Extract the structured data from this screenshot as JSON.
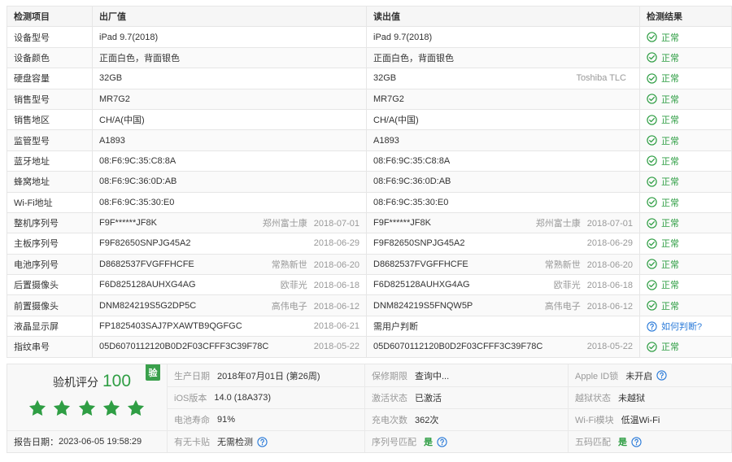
{
  "colors": {
    "ok": "#2f9e44",
    "link": "#2b7bd9",
    "muted": "#999999",
    "text": "#333333",
    "badge": "#3aa04c"
  },
  "table": {
    "headers": {
      "item": "检测项目",
      "factory": "出厂值",
      "read": "读出值",
      "result": "检测结果"
    },
    "rows": [
      {
        "item": "设备型号",
        "factory": {
          "value": "iPad 9.7(2018)"
        },
        "read": {
          "value": "iPad 9.7(2018)"
        },
        "result": {
          "icon": "check-circle-icon",
          "label": "正常"
        }
      },
      {
        "item": "设备颜色",
        "factory": {
          "value": "正面白色，背面银色"
        },
        "read": {
          "value": "正面白色，背面银色"
        },
        "result": {
          "icon": "check-circle-icon",
          "label": "正常"
        }
      },
      {
        "item": "硬盘容量",
        "factory": {
          "value": "32GB"
        },
        "read": {
          "value": "32GB",
          "vendor": "Toshiba TLC"
        },
        "result": {
          "icon": "check-circle-icon",
          "label": "正常"
        }
      },
      {
        "item": "销售型号",
        "factory": {
          "value": "MR7G2"
        },
        "read": {
          "value": "MR7G2"
        },
        "result": {
          "icon": "check-circle-icon",
          "label": "正常"
        }
      },
      {
        "item": "销售地区",
        "factory": {
          "value": "CH/A(中国)"
        },
        "read": {
          "value": "CH/A(中国)"
        },
        "result": {
          "icon": "check-circle-icon",
          "label": "正常"
        }
      },
      {
        "item": "监管型号",
        "factory": {
          "value": "A1893"
        },
        "read": {
          "value": "A1893"
        },
        "result": {
          "icon": "check-circle-icon",
          "label": "正常"
        }
      },
      {
        "item": "蓝牙地址",
        "factory": {
          "value": "08:F6:9C:35:C8:8A"
        },
        "read": {
          "value": "08:F6:9C:35:C8:8A"
        },
        "result": {
          "icon": "check-circle-icon",
          "label": "正常"
        }
      },
      {
        "item": "蜂窝地址",
        "factory": {
          "value": "08:F6:9C:36:0D:AB"
        },
        "read": {
          "value": "08:F6:9C:36:0D:AB"
        },
        "result": {
          "icon": "check-circle-icon",
          "label": "正常"
        }
      },
      {
        "item": "Wi-Fi地址",
        "factory": {
          "value": "08:F6:9C:35:30:E0"
        },
        "read": {
          "value": "08:F6:9C:35:30:E0"
        },
        "result": {
          "icon": "check-circle-icon",
          "label": "正常"
        }
      },
      {
        "item": "整机序列号",
        "factory": {
          "value": "F9F******JF8K",
          "vendor": "郑州富士康",
          "date": "2018-07-01"
        },
        "read": {
          "value": "F9F******JF8K",
          "vendor": "郑州富士康",
          "date": "2018-07-01"
        },
        "result": {
          "icon": "check-circle-icon",
          "label": "正常"
        }
      },
      {
        "item": "主板序列号",
        "factory": {
          "value": "F9F82650SNPJG45A2",
          "date": "2018-06-29"
        },
        "read": {
          "value": "F9F82650SNPJG45A2",
          "date": "2018-06-29"
        },
        "result": {
          "icon": "check-circle-icon",
          "label": "正常"
        }
      },
      {
        "item": "电池序列号",
        "factory": {
          "value": "D8682537FVGFFHCFE",
          "vendor": "常熟新世",
          "date": "2018-06-20"
        },
        "read": {
          "value": "D8682537FVGFFHCFE",
          "vendor": "常熟新世",
          "date": "2018-06-20"
        },
        "result": {
          "icon": "check-circle-icon",
          "label": "正常"
        }
      },
      {
        "item": "后置摄像头",
        "factory": {
          "value": "F6D825128AUHXG4AG",
          "vendor": "欧菲光",
          "date": "2018-06-18"
        },
        "read": {
          "value": "F6D825128AUHXG4AG",
          "vendor": "欧菲光",
          "date": "2018-06-18"
        },
        "result": {
          "icon": "check-circle-icon",
          "label": "正常"
        }
      },
      {
        "item": "前置摄像头",
        "factory": {
          "value": "DNM824219S5G2DP5C",
          "vendor": "高伟电子",
          "date": "2018-06-12"
        },
        "read": {
          "value": "DNM824219S5FNQW5P",
          "vendor": "高伟电子",
          "date": "2018-06-12"
        },
        "result": {
          "icon": "check-circle-icon",
          "label": "正常"
        }
      },
      {
        "item": "液晶显示屏",
        "factory": {
          "value": "FP1825403SAJ7PXAWTB9QGFGC",
          "date": "2018-06-21"
        },
        "read": {
          "value": "需用户判断"
        },
        "result": {
          "icon": "question-circle-icon",
          "label": "如何判断?"
        }
      },
      {
        "item": "指纹串号",
        "factory": {
          "value": "05D6070112120B0D2F03CFFF3C39F78C",
          "date": "2018-05-22"
        },
        "read": {
          "value": "05D6070112120B0D2F03CFFF3C39F78C",
          "date": "2018-05-22"
        },
        "result": {
          "icon": "check-circle-icon",
          "label": "正常"
        }
      }
    ]
  },
  "summary": {
    "score_label": "验机评分",
    "score": "100",
    "badge": "验",
    "rating": {
      "filled": 5,
      "max": 5
    },
    "star_icon": "star-icon",
    "report_date_label": "报告日期：",
    "report_date": "2023-06-05 19:58:29"
  },
  "details": {
    "production_date": {
      "label": "生产日期",
      "value": "2018年07月01日 (第26周)"
    },
    "warranty": {
      "label": "保修期限",
      "value": "查询中..."
    },
    "apple_id_lock": {
      "label": "Apple ID锁",
      "value": "未开启",
      "help": true,
      "help_icon": "question-circle-icon"
    },
    "ios_version": {
      "label": "iOS版本",
      "value": "14.0 (18A373)"
    },
    "activation": {
      "label": "激活状态",
      "value": "已激活"
    },
    "jailbreak": {
      "label": "越狱状态",
      "value": "未越狱"
    },
    "battery_life": {
      "label": "电池寿命",
      "value": "91%"
    },
    "charge_cycles": {
      "label": "充电次数",
      "value": "362次"
    },
    "wifi_module": {
      "label": "Wi-Fi模块",
      "value": "低温Wi-Fi"
    },
    "sim_sticker": {
      "label": "有无卡贴",
      "value": "无需检测",
      "help": true,
      "help_icon": "question-circle-icon"
    },
    "serial_match": {
      "label": "序列号匹配",
      "value": "是",
      "highlight": true,
      "help": true,
      "help_icon": "question-circle-icon"
    },
    "five_code_match": {
      "label": "五码匹配",
      "value": "是",
      "highlight": true,
      "help": true,
      "help_icon": "question-circle-icon"
    }
  }
}
